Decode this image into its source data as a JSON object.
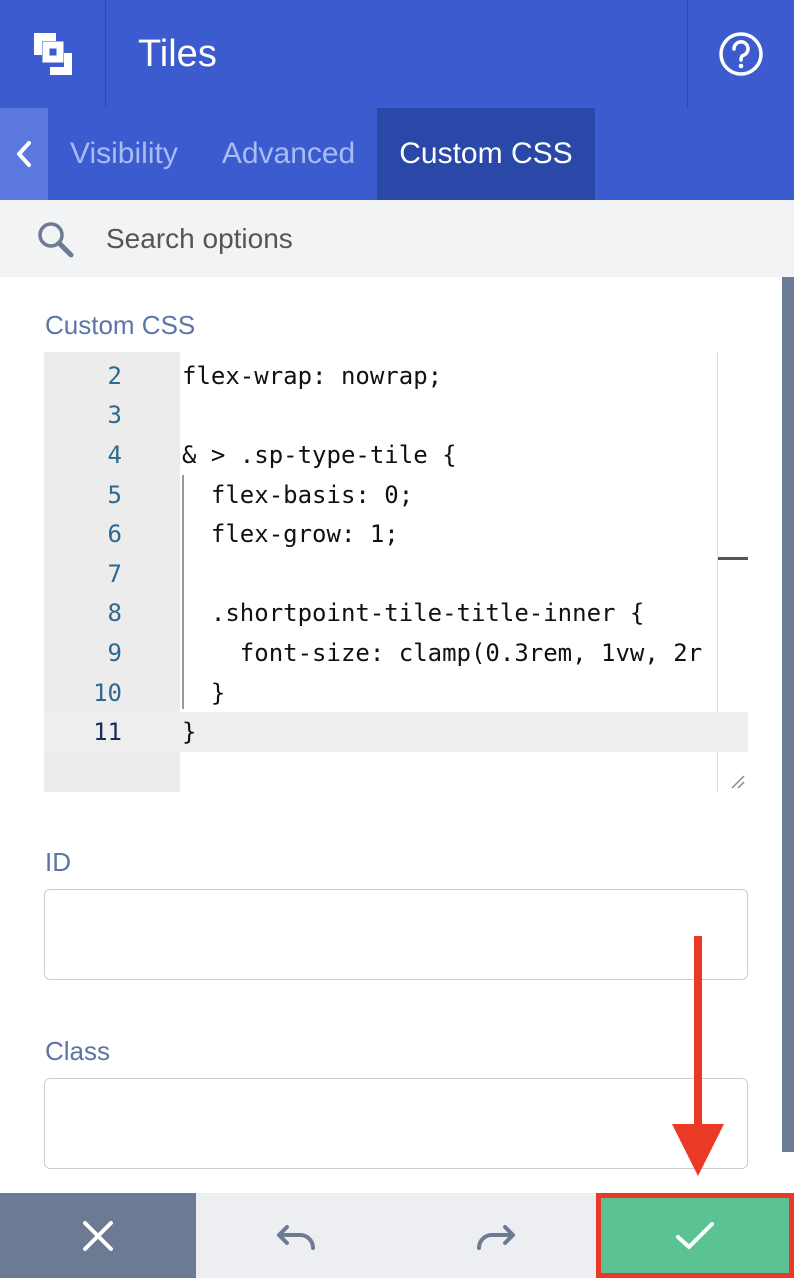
{
  "header": {
    "title": "Tiles",
    "logo_icon": "shortpoint-logo-icon",
    "help_icon": "question-circle-icon"
  },
  "tabs": {
    "back_icon": "chevron-left-icon",
    "items": [
      {
        "label": "Visibility",
        "active": false
      },
      {
        "label": "Advanced",
        "active": false
      },
      {
        "label": "Custom CSS",
        "active": true
      }
    ]
  },
  "search": {
    "placeholder": "Search options",
    "icon": "search-icon"
  },
  "custom_css": {
    "label": "Custom CSS",
    "lines": [
      {
        "num": "2",
        "code": "flex-wrap: nowrap;"
      },
      {
        "num": "3",
        "code": ""
      },
      {
        "num": "4",
        "code": "& > .sp-type-tile {"
      },
      {
        "num": "5",
        "code": "  flex-basis: 0;"
      },
      {
        "num": "6",
        "code": "  flex-grow: 1;"
      },
      {
        "num": "7",
        "code": ""
      },
      {
        "num": "8",
        "code": "  .shortpoint-tile-title-inner {"
      },
      {
        "num": "9",
        "code": "    font-size: clamp(0.3rem, 1vw, 2r"
      },
      {
        "num": "10",
        "code": "  }"
      },
      {
        "num": "11",
        "code": "}"
      }
    ],
    "active_line": "11"
  },
  "id_field": {
    "label": "ID",
    "value": ""
  },
  "class_field": {
    "label": "Class",
    "value": ""
  },
  "footer": {
    "cancel_icon": "close-icon",
    "undo_icon": "undo-icon",
    "redo_icon": "redo-icon",
    "confirm_icon": "checkmark-icon"
  },
  "colors": {
    "header_bg": "#3b5bcf",
    "active_tab_bg": "#2a48a8",
    "confirm_bg": "#5bc294",
    "annotation_red": "#ea3a25"
  }
}
